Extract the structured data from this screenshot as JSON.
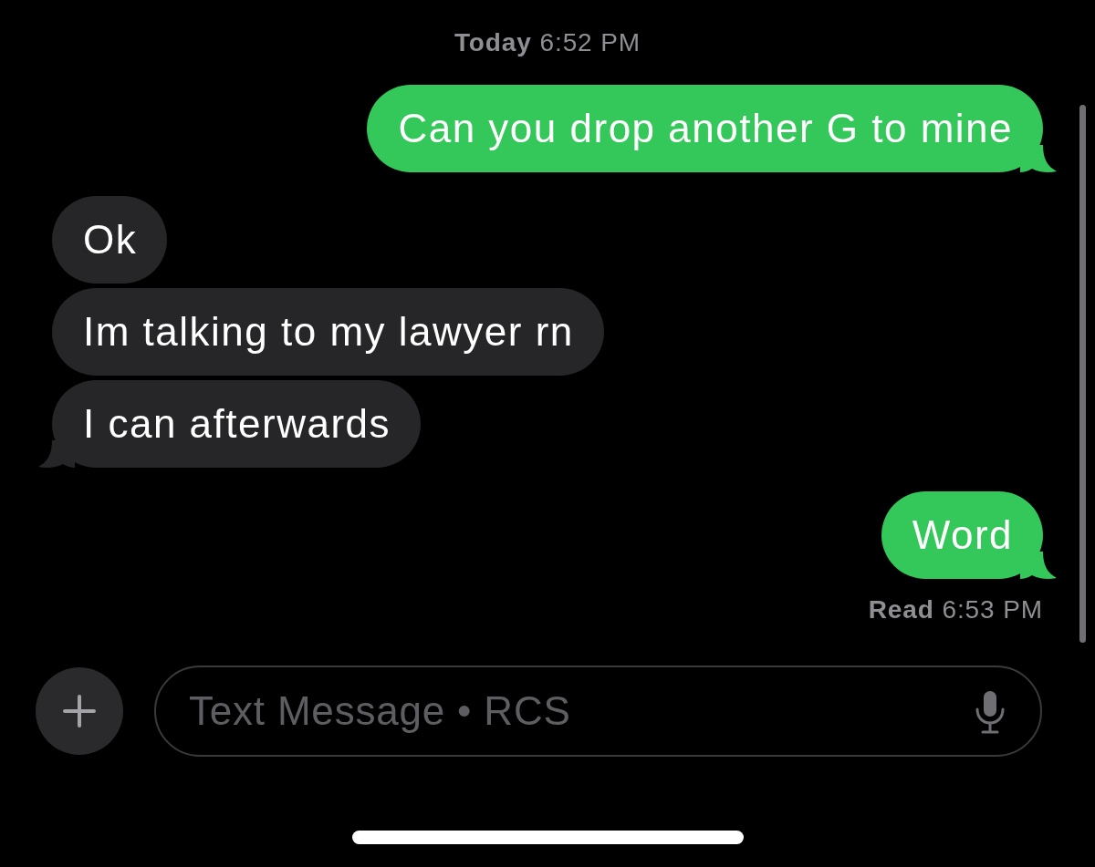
{
  "timestamp": "**Today** 6:52 PM",
  "messages": [
    {
      "kind": "sent",
      "text": "Can you drop another G to mine",
      "tail": true
    },
    {
      "kind": "received",
      "text": "Ok",
      "tail": false
    },
    {
      "kind": "received",
      "text": "Im talking to my lawyer rn",
      "tail": false
    },
    {
      "kind": "received",
      "text": "I can afterwards",
      "tail": true
    },
    {
      "kind": "sent",
      "text": "Word",
      "tail": true
    }
  ],
  "receipt": "**Read** 6:53 PM",
  "composer": {
    "placeholder": "Text Message • RCS"
  }
}
